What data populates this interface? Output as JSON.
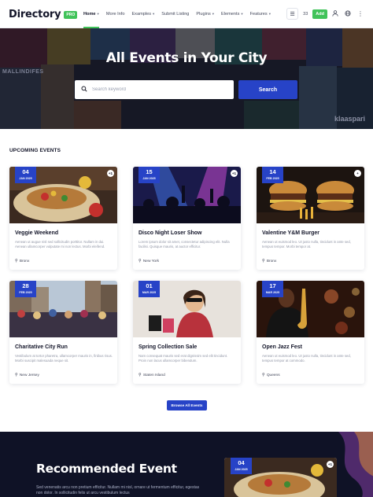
{
  "brand": {
    "name": "Directory",
    "badge": "PRO",
    "accent": "#41c35a",
    "primary": "#2743c7"
  },
  "nav": {
    "items": [
      {
        "label": "Home",
        "dropdown": true,
        "active": true
      },
      {
        "label": "More Info",
        "dropdown": false
      },
      {
        "label": "Examples",
        "dropdown": true
      },
      {
        "label": "Submit Listing",
        "dropdown": false
      },
      {
        "label": "Plugins",
        "dropdown": true
      },
      {
        "label": "Elements",
        "dropdown": true
      },
      {
        "label": "Features",
        "dropdown": true
      }
    ],
    "menu_icon": "hamburger-icon",
    "count": "33",
    "add_label": "Add",
    "user_icon": "user-icon",
    "globe_icon": "globe-icon",
    "more_icon": "more-dots-icon"
  },
  "hero": {
    "title": "All Events in Your City",
    "search_placeholder": "Search keyword",
    "search_button": "Search",
    "poster_text_left": "MALLINDIFES",
    "poster_text_right": "klaaspari"
  },
  "upcoming": {
    "title": "UPCOMING EVENTS",
    "events": [
      {
        "day": "04",
        "month": "JAN 2025",
        "title": "Veggie Weekend",
        "desc": "Aenean ut augue nisl sed sollicitudin porttitor. Nullam in dui. Aenean ullamcorper vulputate mi non lectus. Morbi eleifend.",
        "location": "Bronx",
        "image": "burrito-food-photo"
      },
      {
        "day": "15",
        "month": "JAN 2025",
        "title": "Disco Night Loser Show",
        "desc": "Lorem ipsum dolor sit amet, consectetur adipiscing elit. Nulla facilisi. Quisque mauris, at auctor efficitur.",
        "location": "New York",
        "image": "concert-crowd-photo"
      },
      {
        "day": "14",
        "month": "FEB 2025",
        "title": "Valentine Y&M Burger",
        "desc": "Aenean ut euismod leo. Ut justo nulla, tincidunt in ante sed, tempus tempor. Morbi tempor at.",
        "location": "Bronx",
        "image": "burgers-fries-photo"
      },
      {
        "day": "28",
        "month": "FEB 2025",
        "title": "Charitative City Run",
        "desc": "Vestibulum at tortor pharetra, ullamcorper mauris in, finibus risus. Morbi suscipit malesuada neque sit.",
        "location": "New Jersey",
        "image": "city-crowd-photo"
      },
      {
        "day": "01",
        "month": "MAR 2025",
        "title": "Spring Collection Sale",
        "desc": "Nam consequat mauris sed erat dignissim sed elit tincidunt. Proin non lacus ullamcorper bibendum.",
        "location": "Staten Island",
        "image": "fashion-shopping-photo"
      },
      {
        "day": "17",
        "month": "MAR 2025",
        "title": "Open Jazz Fest",
        "desc": "Aenean ut euismod leo. Ut justo nulla, tincidunt in ante sed, tempus tempor at commodo.",
        "location": "Queens",
        "image": "saxophone-player-photo"
      }
    ],
    "browse_label": "Browse All Events"
  },
  "recommended": {
    "title": "Recommended Event",
    "desc": "Sed venenatis arcu non pretium efficitur. Nullam mi nisl, ornare ut fermentum efficitur, egestas non dolor. In sollicitudin felis ut arcu vestibulum lectus",
    "card_day": "04",
    "card_month": "JAN 2025"
  }
}
